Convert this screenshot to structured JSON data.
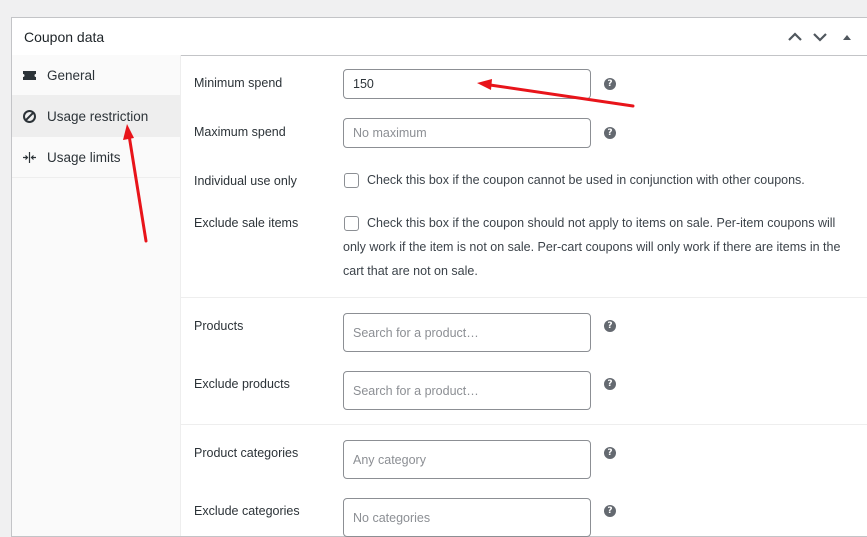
{
  "panel": {
    "title": "Coupon data"
  },
  "header_controls": [
    "chevron-up-icon",
    "chevron-down-icon",
    "triangle-up-icon"
  ],
  "tabs": [
    {
      "label": "General",
      "icon": "ticket-icon",
      "active": false
    },
    {
      "label": "Usage restriction",
      "icon": "ban-icon",
      "active": true
    },
    {
      "label": "Usage limits",
      "icon": "limits-icon",
      "active": false
    }
  ],
  "fields": {
    "minimum_spend": {
      "label": "Minimum spend",
      "value": "150"
    },
    "maximum_spend": {
      "label": "Maximum spend",
      "placeholder": "No maximum"
    },
    "individual_use": {
      "label": "Individual use only",
      "text": "Check this box if the coupon cannot be used in conjunction with other coupons."
    },
    "exclude_sale": {
      "label": "Exclude sale items",
      "text": "Check this box if the coupon should not apply to items on sale. Per-item coupons will only work if the item is not on sale. Per-cart coupons will only work if there are items in the cart that are not on sale."
    },
    "products": {
      "label": "Products",
      "placeholder": "Search for a product…"
    },
    "exclude_products": {
      "label": "Exclude products",
      "placeholder": "Search for a product…"
    },
    "product_categories": {
      "label": "Product categories",
      "placeholder": "Any category"
    },
    "exclude_categories": {
      "label": "Exclude categories",
      "placeholder": "No categories"
    }
  },
  "help_glyph": "?",
  "colors": {
    "annotation_arrow": "#e8141a",
    "active_tab_bg": "#eeeeee"
  }
}
